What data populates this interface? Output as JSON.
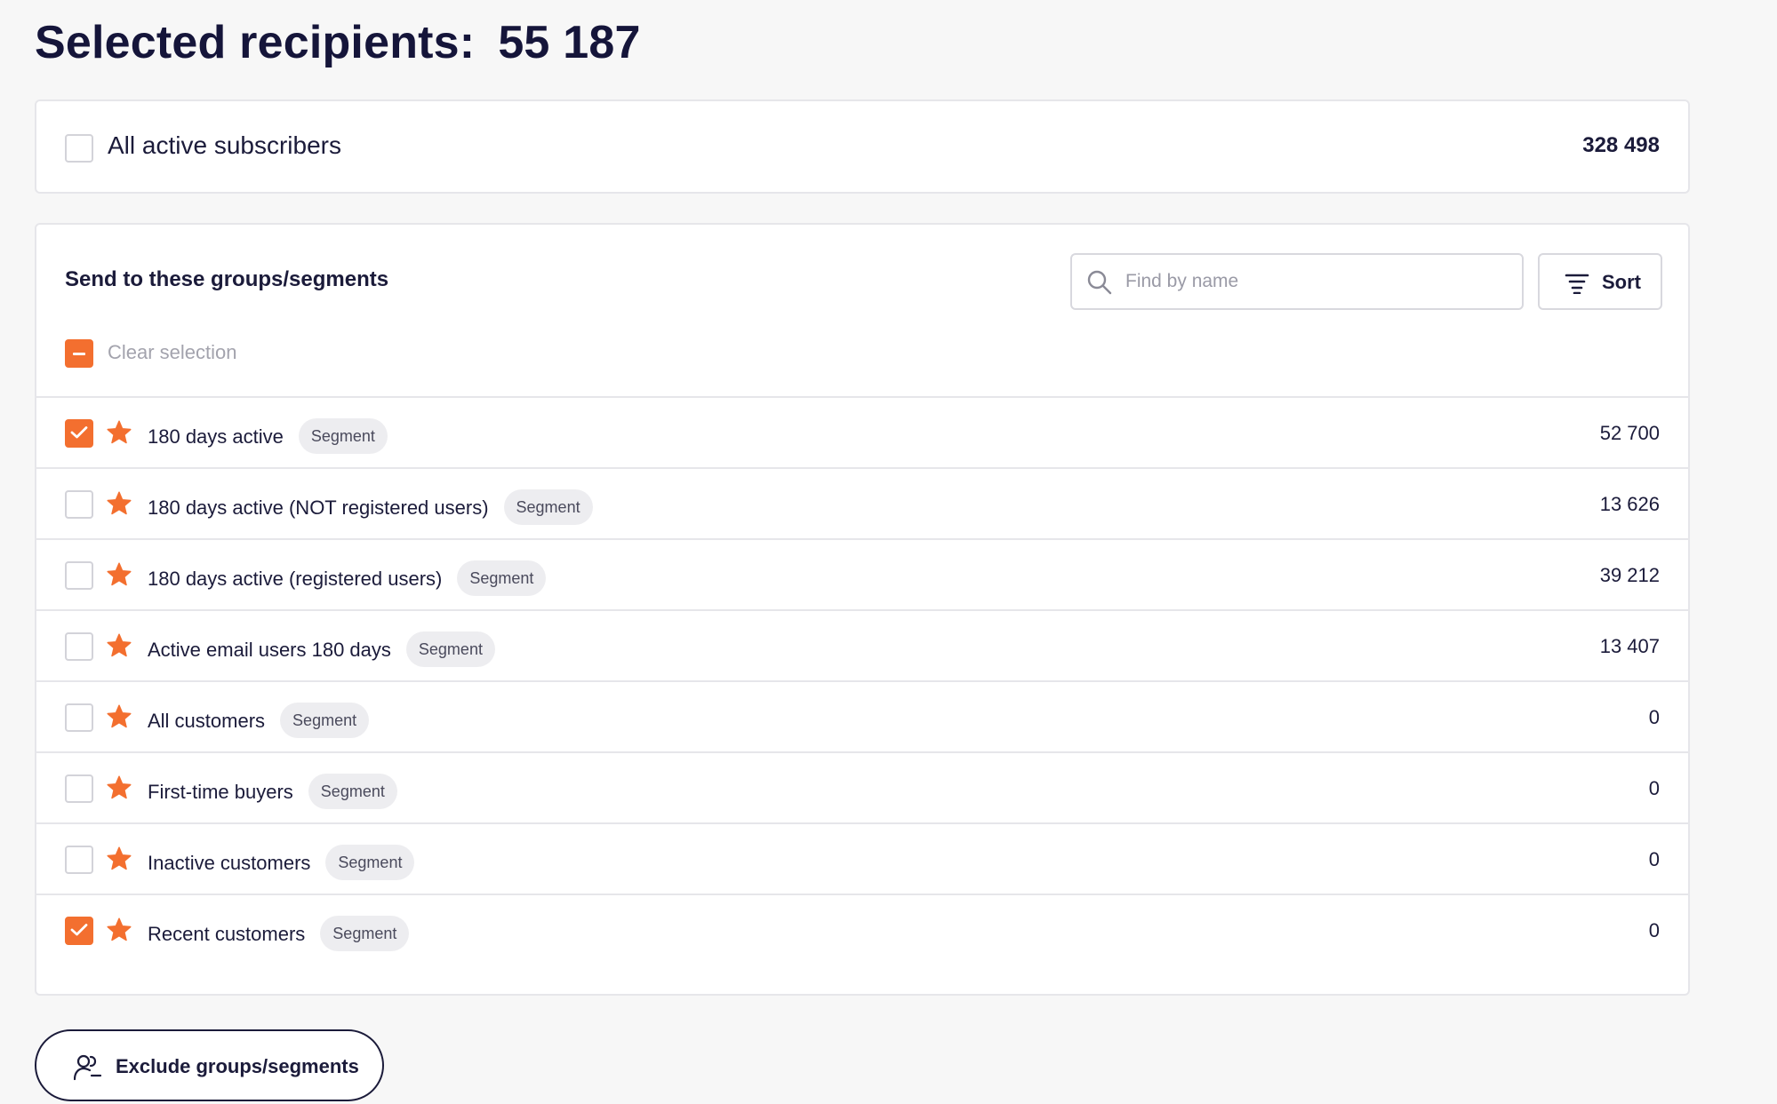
{
  "header": {
    "title": "Selected recipients:",
    "count": "55 187"
  },
  "all_subscribers": {
    "label": "All active subscribers",
    "count": "328 498",
    "checked": false
  },
  "groups": {
    "heading": "Send to these groups/segments",
    "search_placeholder": "Find by name",
    "search_value": "",
    "sort_label": "Sort",
    "clear_label": "Clear selection",
    "items": [
      {
        "name": "180 days active",
        "badge": "Segment",
        "count": "52 700",
        "checked": true
      },
      {
        "name": "180 days active (NOT registered users)",
        "badge": "Segment",
        "count": "13 626",
        "checked": false
      },
      {
        "name": "180 days active (registered users)",
        "badge": "Segment",
        "count": "39 212",
        "checked": false
      },
      {
        "name": "Active email users 180 days",
        "badge": "Segment",
        "count": "13 407",
        "checked": false
      },
      {
        "name": "All customers",
        "badge": "Segment",
        "count": "0",
        "checked": false
      },
      {
        "name": "First-time buyers",
        "badge": "Segment",
        "count": "0",
        "checked": false
      },
      {
        "name": "Inactive customers",
        "badge": "Segment",
        "count": "0",
        "checked": false
      },
      {
        "name": "Recent customers",
        "badge": "Segment",
        "count": "0",
        "checked": true
      }
    ]
  },
  "exclude_button": {
    "label": "Exclude groups/segments",
    "icon": "user-minus-icon"
  },
  "colors": {
    "accent": "#f36f2f",
    "text": "#1b1b3a",
    "muted": "#a3a3ad",
    "border": "#e6e6ea",
    "background": "#f7f7f7"
  }
}
